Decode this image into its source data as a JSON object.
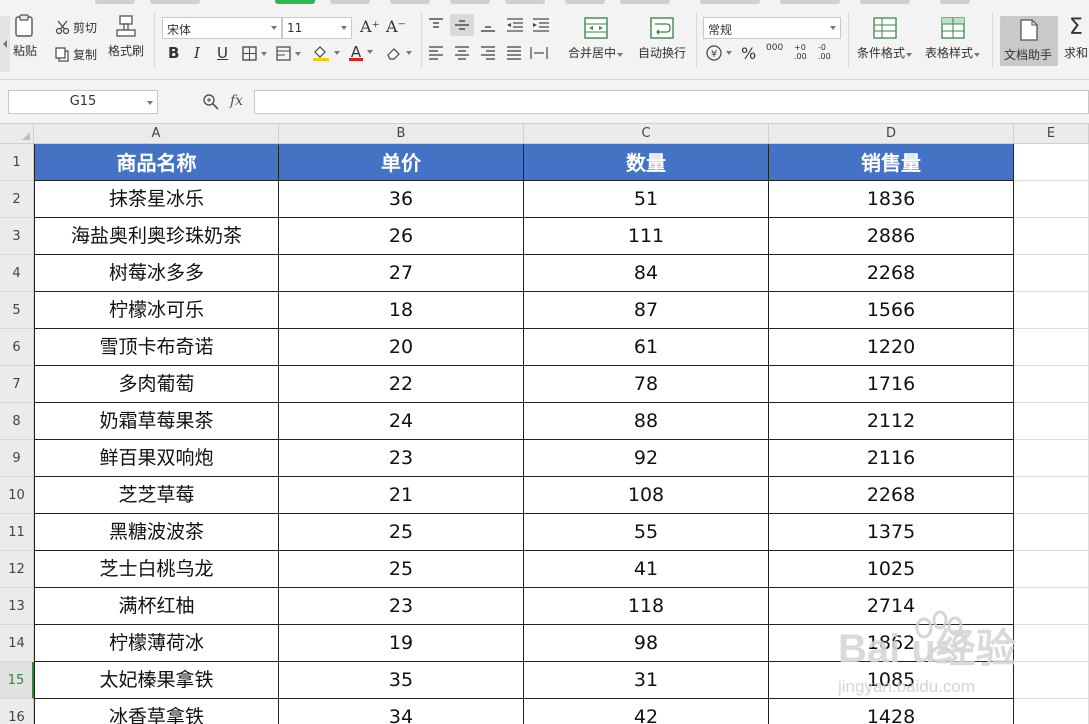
{
  "ribbon": {
    "clipboard": {
      "paste_label": "粘贴",
      "cut_label": "剪切",
      "copy_label": "复制",
      "format_painter_label": "格式刷"
    },
    "font": {
      "font_name": "宋体",
      "font_size": "11",
      "bold": "B",
      "italic": "I",
      "underline": "U",
      "increase_size": "A⁺",
      "decrease_size": "A⁻",
      "font_color": "A"
    },
    "alignment": {
      "merge_label": "合并居中",
      "wrap_label": "自动换行"
    },
    "number": {
      "format_value": "常规",
      "percent": "%",
      "thousands": "000",
      "inc_decimal": "+0 .00",
      "dec_decimal": "-0 .00"
    },
    "styles": {
      "conditional_label": "条件格式",
      "table_style_label": "表格样式"
    },
    "doc_helper_label": "文档助手",
    "sum_label": "求和"
  },
  "formula_bar": {
    "cell_ref": "G15",
    "fx_label": "fx",
    "formula_value": ""
  },
  "columns": [
    "A",
    "B",
    "C",
    "D",
    "E"
  ],
  "row_numbers": [
    "1",
    "2",
    "3",
    "4",
    "5",
    "6",
    "7",
    "8",
    "9",
    "10",
    "11",
    "12",
    "13",
    "14",
    "15",
    "16"
  ],
  "active_row": "15",
  "table": {
    "header": [
      "商品名称",
      "单价",
      "数量",
      "销售量"
    ],
    "rows": [
      [
        "抹茶星冰乐",
        "36",
        "51",
        "1836"
      ],
      [
        "海盐奥利奥珍珠奶茶",
        "26",
        "111",
        "2886"
      ],
      [
        "树莓冰多多",
        "27",
        "84",
        "2268"
      ],
      [
        "柠檬冰可乐",
        "18",
        "87",
        "1566"
      ],
      [
        "雪顶卡布奇诺",
        "20",
        "61",
        "1220"
      ],
      [
        "多肉葡萄",
        "22",
        "78",
        "1716"
      ],
      [
        "奶霜草莓果茶",
        "24",
        "88",
        "2112"
      ],
      [
        "鲜百果双响炮",
        "23",
        "92",
        "2116"
      ],
      [
        "芝芝草莓",
        "21",
        "108",
        "2268"
      ],
      [
        "黑糖波波茶",
        "25",
        "55",
        "1375"
      ],
      [
        "芝士白桃乌龙",
        "25",
        "41",
        "1025"
      ],
      [
        "满杯红柚",
        "23",
        "118",
        "2714"
      ],
      [
        "柠檬薄荷冰",
        "19",
        "98",
        "1862"
      ],
      [
        "太妃榛果拿铁",
        "35",
        "31",
        "1085"
      ],
      [
        "冰香草拿铁",
        "34",
        "42",
        "1428"
      ]
    ]
  },
  "colors": {
    "header_fill": "#4472c4",
    "header_text": "#ffffff",
    "active_row": "#2a8a3a"
  },
  "watermark": {
    "brand": "Baidu经验",
    "url": "jingyan.baidu.com"
  }
}
